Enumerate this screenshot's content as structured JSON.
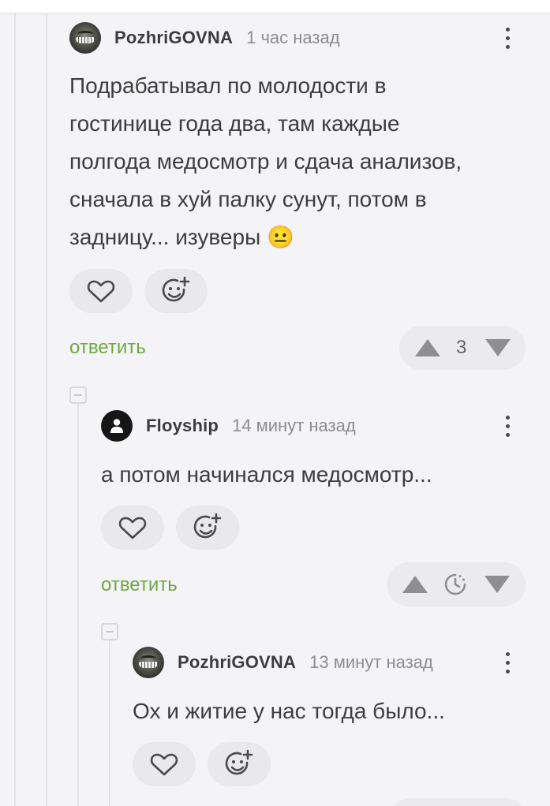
{
  "comments": [
    {
      "username": "PozhriGOVNA",
      "time": "1 час назад",
      "text_lines": [
        "Подрабатывал по молодости в",
        "гостинице года два, там каждые",
        "полгода медосмотр и сдача анализов,",
        "сначала в хуй палку сунут, потом в",
        "задницу... изуверы 😐"
      ],
      "reply_label": "ответить",
      "vote_count": "3"
    },
    {
      "username": "Floyship",
      "time": "14 минут назад",
      "text_lines": [
        "а потом начинался медосмотр..."
      ],
      "reply_label": "ответить",
      "vote_status_icon": "timer-icon"
    },
    {
      "username": "PozhriGOVNA",
      "time": "13 минут назад",
      "text_lines": [
        "Ох и житие у нас тогда было..."
      ]
    }
  ],
  "colors": {
    "reply_link": "#6fa843",
    "background": "#f4f4f6",
    "pill": "#e9e9ed"
  }
}
